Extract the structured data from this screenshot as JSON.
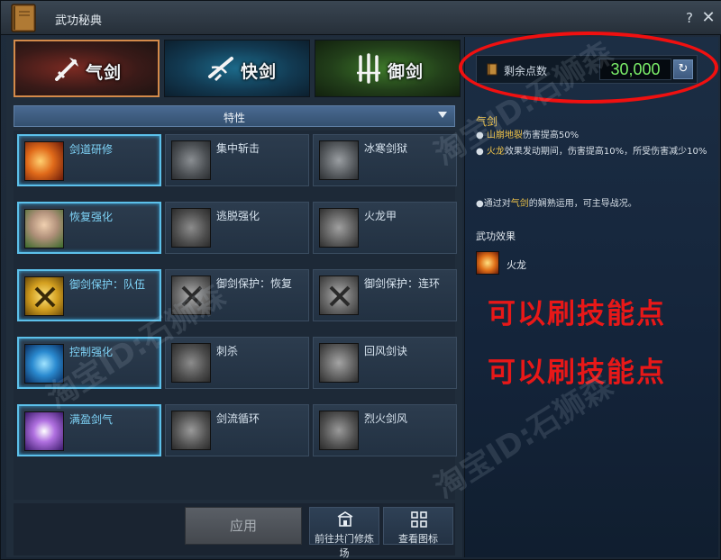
{
  "window": {
    "title": "武功秘典",
    "help_label": "?",
    "close_label": "✕"
  },
  "tabs": [
    {
      "label": "气剑",
      "icon": "flame-sword-icon",
      "active": true
    },
    {
      "label": "快剑",
      "icon": "swift-sword-icon",
      "active": false
    },
    {
      "label": "御剑",
      "icon": "triple-sword-icon",
      "active": false
    }
  ],
  "trait_dropdown": {
    "label": "特性"
  },
  "skills": [
    {
      "name": "剑道研修",
      "active": true
    },
    {
      "name": "集中斩击",
      "active": false
    },
    {
      "name": "冰寒剑狱",
      "active": false
    },
    {
      "name": "恢复强化",
      "active": true
    },
    {
      "name": "逃脱强化",
      "active": false
    },
    {
      "name": "火龙甲",
      "active": false
    },
    {
      "name": "御剑保护：队伍",
      "active": true
    },
    {
      "name": "御剑保护：恢复",
      "active": false
    },
    {
      "name": "御剑保护：连环",
      "active": false
    },
    {
      "name": "控制强化",
      "active": true
    },
    {
      "name": "刺杀",
      "active": false
    },
    {
      "name": "回风剑诀",
      "active": false
    },
    {
      "name": "满盈剑气",
      "active": true
    },
    {
      "name": "剑流循环",
      "active": false
    },
    {
      "name": "烈火剑风",
      "active": false
    }
  ],
  "bottom": {
    "apply_label": "应用",
    "training_label": "前往共门修炼场",
    "view_icons_label": "查看图标"
  },
  "points": {
    "label": "剩余点数",
    "value": "30,000",
    "reset_icon": "refresh-icon"
  },
  "description": {
    "title": "气剑",
    "line1_highlight": "山崩地裂",
    "line1_rest": "伤害提高50%",
    "line2_highlight": "火龙",
    "line2_rest": "效果发动期间，伤害提高10%，所受伤害减少10%",
    "line3_pre": "●通过对",
    "line3_highlight": "气剑",
    "line3_post": "的娴熟运用，可主导战况。",
    "effect_title": "武功效果",
    "effect_name": "火龙"
  },
  "overlay": {
    "red_text_1": "可以刷技能点",
    "red_text_2": "可以刷技能点"
  },
  "watermark": {
    "text_1": "淘宝ID:石狮森",
    "text_2": "淘宝ID:石狮森",
    "text_3": "淘宝ID:石狮森"
  },
  "colors": {
    "accent_blue": "#5cc0ea",
    "points_green": "#7cf06a",
    "highlight_yellow": "#f0c44a",
    "annotation_red": "#e81818"
  }
}
